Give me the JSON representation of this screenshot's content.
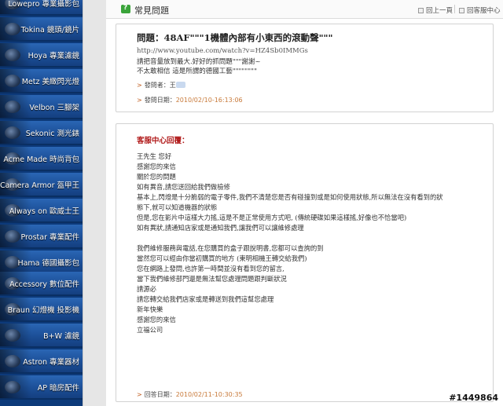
{
  "sidebar": {
    "items": [
      {
        "label": "Lowepro 專業攝影包"
      },
      {
        "label": "Tokina 鏡頭/鏡片"
      },
      {
        "label": "Hoya 專業濾鏡"
      },
      {
        "label": "Metz 美緻閃光燈"
      },
      {
        "label": "Velbon 三腳架"
      },
      {
        "label": "Sekonic 測光錶"
      },
      {
        "label": "Acme Made 時尚背包"
      },
      {
        "label": "Camera Armor 盔甲王"
      },
      {
        "label": "Always on 歐威士王"
      },
      {
        "label": "Prostar 專業配件"
      },
      {
        "label": "Hama 德國攝影包"
      },
      {
        "label": "Accessory 數位配件"
      },
      {
        "label": "Braun 幻燈機 投影機"
      },
      {
        "label": "B+W 濾鏡"
      },
      {
        "label": "Astron 專業器材"
      },
      {
        "label": "AP 暗房配件"
      }
    ]
  },
  "header": {
    "title": "常見問題",
    "back_label": "回上一頁",
    "home_label": "回客服中心"
  },
  "question": {
    "title": "問題：48AF\"\"\"1機體內部有小東西的滾動聲\"\"\"",
    "lines": [
      "http://www.youtube.com/watch?v=HZ4Sb0IMMGs",
      "請把音量放到最大.好好的抓問題\"\"\"謝謝~",
      "不太敢相信 這是所謂的德國工藝\"\"\"\"\"\"\"\""
    ],
    "asker_label": "發問者：",
    "asker_name": "王",
    "date_label": "發問日期：",
    "date_value": "2010/02/10-16:13:06"
  },
  "answer": {
    "title": "客服中心回覆：",
    "lines": [
      "王先生 您好",
      "感謝您的來信",
      "關於您的問題",
      "如有異音,請您送回給我們做檢修",
      "基本上,閃燈是十分脆弱的電子零件,我們不清楚您是否有碰撞到或是如何使用狀態,所以無法在沒有看到的狀",
      "態下,就可以知道機器的狀態",
      "但是,您在影片中這樣大力搖,這是不是正常使用方式吧, (傳統硬碟如果這樣搖,好像也不恰當吧)",
      "如有異狀,請通知店家或是通知我們,讓我們可以讓維修處理",
      "",
      "我們維修服務與電話,在您購買的盒子跟說明書,您都可以查詢的到",
      "當然您可以經由你當初購買的地方 (東明相機王轉交給我們)",
      "您在網路上發問,也許第一時間並沒有看到您的留言,",
      "當下我們維修部門還是無法幫您處理問題跟判斷狀況",
      "請源必",
      "請您轉交給我們店家或是轉送到我們這幫您處理",
      "新年快樂",
      "感謝您的來信",
      "立福公司"
    ],
    "date_label": "回答日期：",
    "date_value": "2010/02/11-10:30:35"
  },
  "watermark": "#1449864"
}
